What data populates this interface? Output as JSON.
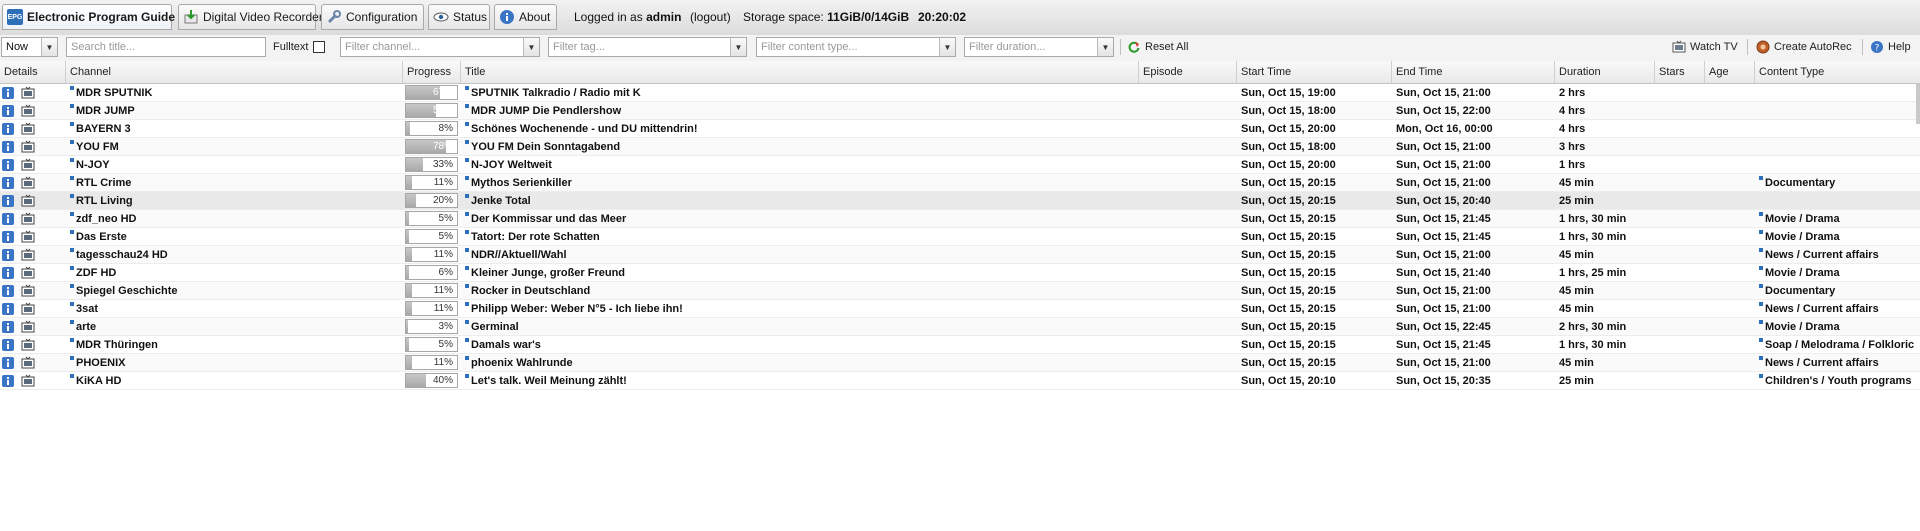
{
  "tabs": [
    {
      "label": "Electronic Program Guide",
      "icon": "epg-icon",
      "active": true
    },
    {
      "label": "Digital Video Recorder",
      "icon": "dvr-icon",
      "active": false
    },
    {
      "label": "Configuration",
      "icon": "wrench-icon",
      "active": false
    },
    {
      "label": "Status",
      "icon": "eye-icon",
      "active": false
    },
    {
      "label": "About",
      "icon": "info-icon",
      "active": false
    }
  ],
  "status": {
    "logged_in_prefix": "Logged in as",
    "user": "admin",
    "logout": "(logout)",
    "storage_label": "Storage space:",
    "storage_value": "11GiB/0/14GiB",
    "clock": "20:20:02"
  },
  "filters": {
    "time_select": "Now",
    "title_placeholder": "Search title...",
    "fulltext_label": "Fulltext",
    "channel_placeholder": "Filter channel...",
    "tag_placeholder": "Filter tag...",
    "content_placeholder": "Filter content type...",
    "duration_placeholder": "Filter duration...",
    "reset_label": "Reset All",
    "watch_tv_label": "Watch TV",
    "autorec_label": "Create AutoRec",
    "help_label": "Help"
  },
  "columns": {
    "details": "Details",
    "channel": "Channel",
    "progress": "Progress",
    "title": "Title",
    "episode": "Episode",
    "start": "Start Time",
    "end": "End Time",
    "duration": "Duration",
    "stars": "Stars",
    "age": "Age",
    "content": "Content Type"
  },
  "rows": [
    {
      "channel": "MDR SPUTNIK",
      "progress": "67%",
      "title": "SPUTNIK Talkradio / Radio mit K",
      "episode": "",
      "start": "Sun, Oct 15, 19:00",
      "end": "Sun, Oct 15, 21:00",
      "duration": "2 hrs",
      "content": ""
    },
    {
      "channel": "MDR JUMP",
      "progress": "58%",
      "title": "MDR JUMP Die Pendlershow",
      "episode": "",
      "start": "Sun, Oct 15, 18:00",
      "end": "Sun, Oct 15, 22:00",
      "duration": "4 hrs",
      "content": ""
    },
    {
      "channel": "BAYERN 3",
      "progress": "8%",
      "title": "Schönes Wochenende - und DU mittendrin!",
      "episode": "",
      "start": "Sun, Oct 15, 20:00",
      "end": "Mon, Oct 16, 00:00",
      "duration": "4 hrs",
      "content": ""
    },
    {
      "channel": "YOU FM",
      "progress": "78%",
      "title": "YOU FM Dein Sonntagabend",
      "episode": "",
      "start": "Sun, Oct 15, 18:00",
      "end": "Sun, Oct 15, 21:00",
      "duration": "3 hrs",
      "content": ""
    },
    {
      "channel": "N-JOY",
      "progress": "33%",
      "title": "N-JOY Weltweit",
      "episode": "",
      "start": "Sun, Oct 15, 20:00",
      "end": "Sun, Oct 15, 21:00",
      "duration": "1 hrs",
      "content": ""
    },
    {
      "channel": "RTL Crime",
      "progress": "11%",
      "title": "Mythos Serienkiller",
      "episode": "",
      "start": "Sun, Oct 15, 20:15",
      "end": "Sun, Oct 15, 21:00",
      "duration": "45 min",
      "content": "Documentary"
    },
    {
      "channel": "RTL Living",
      "progress": "20%",
      "title": "Jenke Total",
      "episode": "",
      "start": "Sun, Oct 15, 20:15",
      "end": "Sun, Oct 15, 20:40",
      "duration": "25 min",
      "content": ""
    },
    {
      "channel": "zdf_neo HD",
      "progress": "5%",
      "title": "Der Kommissar und das Meer",
      "episode": "",
      "start": "Sun, Oct 15, 20:15",
      "end": "Sun, Oct 15, 21:45",
      "duration": "1 hrs, 30 min",
      "content": "Movie / Drama"
    },
    {
      "channel": "Das Erste",
      "progress": "5%",
      "title": "Tatort: Der rote Schatten",
      "episode": "",
      "start": "Sun, Oct 15, 20:15",
      "end": "Sun, Oct 15, 21:45",
      "duration": "1 hrs, 30 min",
      "content": "Movie / Drama"
    },
    {
      "channel": "tagesschau24 HD",
      "progress": "11%",
      "title": "NDR//Aktuell/Wahl",
      "episode": "",
      "start": "Sun, Oct 15, 20:15",
      "end": "Sun, Oct 15, 21:00",
      "duration": "45 min",
      "content": "News / Current affairs"
    },
    {
      "channel": "ZDF HD",
      "progress": "6%",
      "title": "Kleiner Junge, großer Freund",
      "episode": "",
      "start": "Sun, Oct 15, 20:15",
      "end": "Sun, Oct 15, 21:40",
      "duration": "1 hrs, 25 min",
      "content": "Movie / Drama"
    },
    {
      "channel": "Spiegel Geschichte",
      "progress": "11%",
      "title": "Rocker in Deutschland",
      "episode": "",
      "start": "Sun, Oct 15, 20:15",
      "end": "Sun, Oct 15, 21:00",
      "duration": "45 min",
      "content": "Documentary"
    },
    {
      "channel": "3sat",
      "progress": "11%",
      "title": "Philipp Weber: Weber N°5 - Ich liebe ihn!",
      "episode": "",
      "start": "Sun, Oct 15, 20:15",
      "end": "Sun, Oct 15, 21:00",
      "duration": "45 min",
      "content": "News / Current affairs"
    },
    {
      "channel": "arte",
      "progress": "3%",
      "title": "Germinal",
      "episode": "",
      "start": "Sun, Oct 15, 20:15",
      "end": "Sun, Oct 15, 22:45",
      "duration": "2 hrs, 30 min",
      "content": "Movie / Drama"
    },
    {
      "channel": "MDR Thüringen",
      "progress": "5%",
      "title": "Damals war's",
      "episode": "",
      "start": "Sun, Oct 15, 20:15",
      "end": "Sun, Oct 15, 21:45",
      "duration": "1 hrs, 30 min",
      "content": "Soap / Melodrama / Folkloric"
    },
    {
      "channel": "PHOENIX",
      "progress": "11%",
      "title": "phoenix Wahlrunde",
      "episode": "",
      "start": "Sun, Oct 15, 20:15",
      "end": "Sun, Oct 15, 21:00",
      "duration": "45 min",
      "content": "News / Current affairs"
    },
    {
      "channel": "KiKA HD",
      "progress": "40%",
      "title": "Let's talk. Weil Meinung zählt!",
      "episode": "",
      "start": "Sun, Oct 15, 20:10",
      "end": "Sun, Oct 15, 20:35",
      "duration": "25 min",
      "content": "Children's / Youth programs"
    }
  ],
  "colors": {
    "accent": "#2d6fb8",
    "progress_fill": "#b4b4b4",
    "highlight_row": "#e9e9e9"
  }
}
